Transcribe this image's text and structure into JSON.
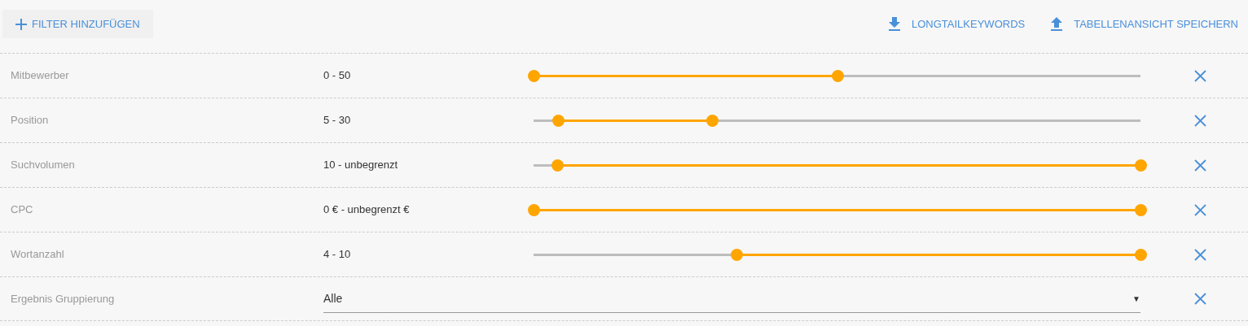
{
  "toolbar": {
    "add_filter": "FILTER HINZUFÜGEN",
    "actions": [
      {
        "kind": "download",
        "label": "LONGTAILKEYWORDS"
      },
      {
        "kind": "upload",
        "label": "TABELLENANSICHT SPEICHERN"
      }
    ]
  },
  "filters": [
    {
      "kind": "range",
      "label": "Mitbewerber",
      "value": "0 - 50",
      "thumbs": [
        {
          "level": 0
        },
        {
          "level": 0.5
        }
      ]
    },
    {
      "kind": "range",
      "label": "Position",
      "value": "5 - 30",
      "thumbs": [
        {
          "level": 0.04
        },
        {
          "level": 0.294
        }
      ]
    },
    {
      "kind": "range",
      "label": "Suchvolumen",
      "value": "10 - unbegrenzt",
      "thumbs": [
        {
          "level": 0.039
        },
        {
          "level": 1
        }
      ]
    },
    {
      "kind": "range",
      "label": "CPC",
      "value": "0 € - unbegrenzt €",
      "thumbs": [
        {
          "level": 0
        },
        {
          "level": 1
        }
      ]
    },
    {
      "kind": "range",
      "label": "Wortanzahl",
      "value": "4 - 10",
      "thumbs": [
        {
          "level": 0.334
        },
        {
          "level": 1
        }
      ]
    },
    {
      "kind": "select",
      "label": "Ergebnis Gruppierung",
      "value": "Alle",
      "caret": "▼"
    }
  ]
}
